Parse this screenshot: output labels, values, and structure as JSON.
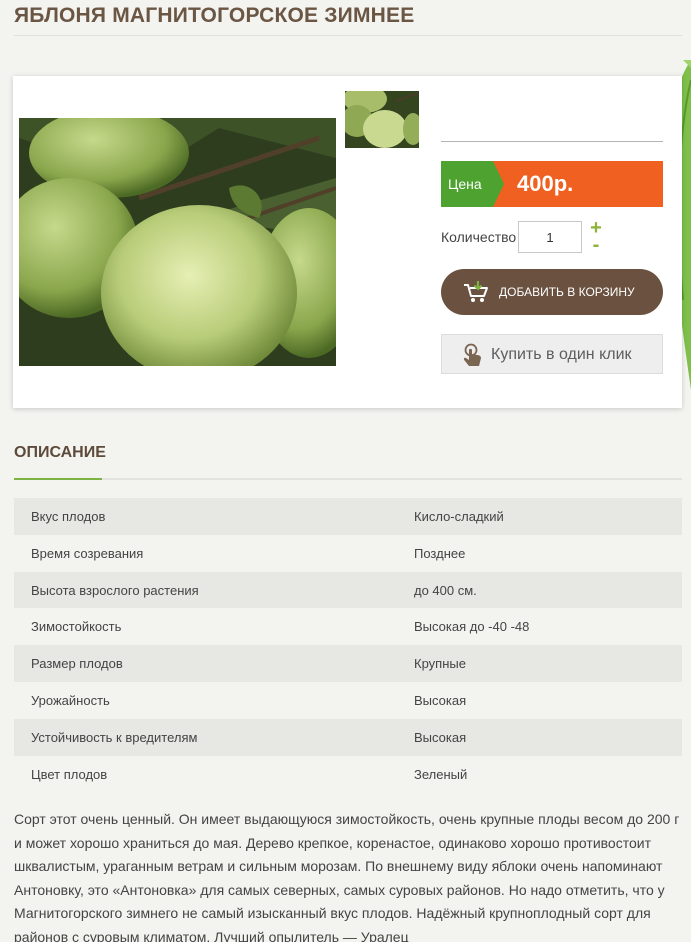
{
  "product": {
    "title": "ЯБЛОНЯ МАГНИТОГОРСКОЕ ЗИМНЕЕ",
    "main_photo_alt": "",
    "price_label": "Цена",
    "price": "400р.",
    "quantity_label": "Количество",
    "quantity_value": "1",
    "qty_plus": "+",
    "qty_minus": "-",
    "add_to_cart": "ДОБАВИТЬ В КОРЗИНУ",
    "buy_one_click": "Купить в один клик"
  },
  "colors": {
    "title": "#6b5644",
    "price_label_bg": "#4ea230",
    "price_value_bg": "#f06020",
    "cart_button_bg": "#6b5140",
    "accent_green": "#7cb342"
  },
  "icons": {
    "cart": "cart-icon",
    "one_click": "touch-icon",
    "leaf": "leaf-icon"
  },
  "description_section": {
    "title": "ОПИСАНИЕ",
    "specs": [
      {
        "name": "Вкус плодов",
        "value": "Кисло-сладкий"
      },
      {
        "name": "Время созревания",
        "value": "Позднее"
      },
      {
        "name": "Высота взрослого растения",
        "value": "до 400 см."
      },
      {
        "name": "Зимостойкость",
        "value": "Высокая до -40 -48"
      },
      {
        "name": "Размер плодов",
        "value": "Крупные"
      },
      {
        "name": "Урожайность",
        "value": "Высокая"
      },
      {
        "name": "Устойчивость к вредителям",
        "value": "Высокая"
      },
      {
        "name": "Цвет плодов",
        "value": "Зеленый"
      }
    ],
    "text_lines": [
      "Сорт этот очень ценный. Он имеет выдающуюся зимостойкость, очень крупные плоды весом до 200 г",
      "и может хорошо храниться до мая. Дерево крепкое, коренастое, одинаково хорошо противостоит",
      "шквалистым, ураганным ветрам и сильным морозам. По внешнему виду яблоки очень напоминают",
      "Антоновку, это «Антоновка» для самых северных, самых суровых районов. Но надо отметить, что у",
      "Магнитогорского зимнего не самый изысканный вкус плодов. Надёжный крупноплодный сорт для",
      "районов с суровым климатом. Лучший опылитель — Уралец"
    ]
  }
}
